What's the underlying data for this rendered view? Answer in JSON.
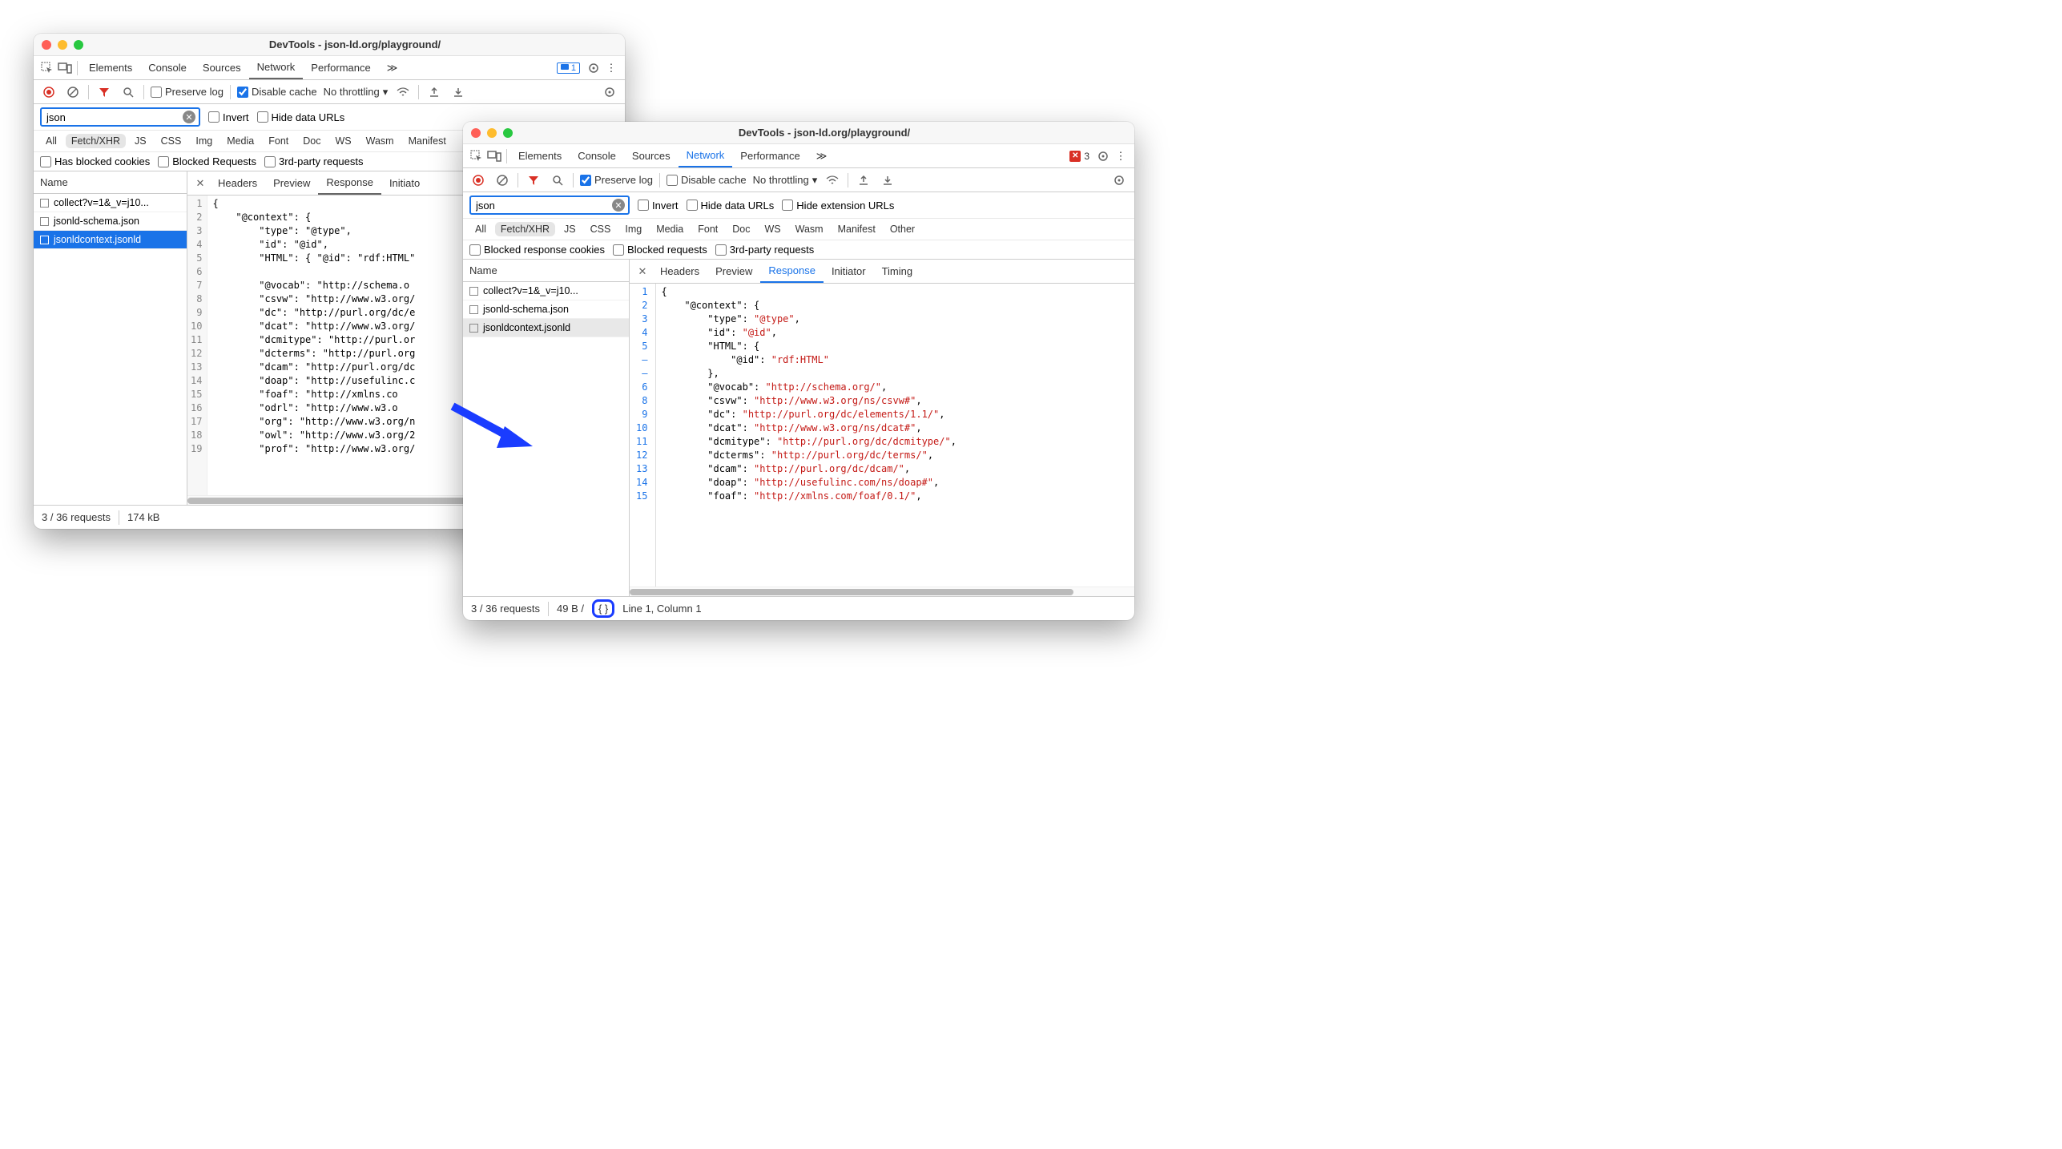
{
  "windowA": {
    "title": "DevTools - json-ld.org/playground/",
    "tabs": [
      "Elements",
      "Console",
      "Sources",
      "Network",
      "Performance"
    ],
    "activeTab": "Network",
    "more": "≫",
    "msgBadge": "1",
    "toolbar": {
      "preserve": "Preserve log",
      "disableCache": "Disable cache",
      "throttling": "No throttling"
    },
    "filter": {
      "value": "json",
      "invert": "Invert",
      "hideData": "Hide data URLs"
    },
    "types": [
      "All",
      "Fetch/XHR",
      "JS",
      "CSS",
      "Img",
      "Media",
      "Font",
      "Doc",
      "WS",
      "Wasm",
      "Manifest"
    ],
    "activeType": "Fetch/XHR",
    "extraFilters": {
      "blockedCookies": "Has blocked cookies",
      "blockedReq": "Blocked Requests",
      "thirdParty": "3rd-party requests"
    },
    "nameHeader": "Name",
    "requests": [
      "collect?v=1&_v=j10...",
      "jsonld-schema.json",
      "jsonldcontext.jsonld"
    ],
    "selectedReq": 2,
    "detailTabs": [
      "Headers",
      "Preview",
      "Response",
      "Initiato"
    ],
    "activeDetail": "Response",
    "gutter": [
      "1",
      "2",
      "3",
      "4",
      "5",
      "6",
      "7",
      "8",
      "9",
      "10",
      "11",
      "12",
      "13",
      "14",
      "15",
      "16",
      "17",
      "18",
      "19"
    ],
    "codePlain": [
      "{",
      "    \"@context\": {",
      "        \"type\": \"@type\",",
      "        \"id\": \"@id\",",
      "        \"HTML\": { \"@id\": \"rdf:HTML\"",
      "",
      "        \"@vocab\": \"http://schema.o",
      "        \"csvw\": \"http://www.w3.org/",
      "        \"dc\": \"http://purl.org/dc/e",
      "        \"dcat\": \"http://www.w3.org/",
      "        \"dcmitype\": \"http://purl.or",
      "        \"dcterms\": \"http://purl.org",
      "        \"dcam\": \"http://purl.org/dc",
      "        \"doap\": \"http://usefulinc.c",
      "        \"foaf\": \"http://xmlns.co",
      "        \"odrl\": \"http://www.w3.o",
      "        \"org\": \"http://www.w3.org/n",
      "        \"owl\": \"http://www.w3.org/2",
      "        \"prof\": \"http://www.w3.org/"
    ],
    "status": {
      "requests": "3 / 36 requests",
      "size": "174 kB"
    }
  },
  "windowB": {
    "title": "DevTools - json-ld.org/playground/",
    "tabs": [
      "Elements",
      "Console",
      "Sources",
      "Network",
      "Performance"
    ],
    "activeTab": "Network",
    "more": "≫",
    "errBadge": "3",
    "toolbar": {
      "preserve": "Preserve log",
      "disableCache": "Disable cache",
      "throttling": "No throttling"
    },
    "filter": {
      "value": "json",
      "invert": "Invert",
      "hideData": "Hide data URLs",
      "hideExt": "Hide extension URLs"
    },
    "types": [
      "All",
      "Fetch/XHR",
      "JS",
      "CSS",
      "Img",
      "Media",
      "Font",
      "Doc",
      "WS",
      "Wasm",
      "Manifest",
      "Other"
    ],
    "activeType": "Fetch/XHR",
    "extraFilters": {
      "blockedCookies": "Blocked response cookies",
      "blockedReq": "Blocked requests",
      "thirdParty": "3rd-party requests"
    },
    "nameHeader": "Name",
    "requests": [
      "collect?v=1&_v=j10...",
      "jsonld-schema.json",
      "jsonldcontext.jsonld"
    ],
    "selectedReq": 2,
    "detailTabs": [
      "Headers",
      "Preview",
      "Response",
      "Initiator",
      "Timing"
    ],
    "activeDetail": "Response",
    "gutter": [
      "1",
      "2",
      "3",
      "4",
      "5",
      "–",
      "–",
      "6",
      "8",
      "9",
      "10",
      "11",
      "12",
      "13",
      "14",
      "15"
    ],
    "codeLines": [
      {
        "indent": 0,
        "pre": "{"
      },
      {
        "indent": 1,
        "key": "\"@context\"",
        "post": ": {"
      },
      {
        "indent": 2,
        "key": "\"type\"",
        "mid": ": ",
        "val": "\"@type\"",
        "post": ","
      },
      {
        "indent": 2,
        "key": "\"id\"",
        "mid": ": ",
        "val": "\"@id\"",
        "post": ","
      },
      {
        "indent": 2,
        "key": "\"HTML\"",
        "post": ": {"
      },
      {
        "indent": 3,
        "key": "\"@id\"",
        "mid": ": ",
        "val": "\"rdf:HTML\""
      },
      {
        "indent": 2,
        "pre": "},"
      },
      {
        "indent": 2,
        "key": "\"@vocab\"",
        "mid": ": ",
        "val": "\"http://schema.org/\"",
        "post": ","
      },
      {
        "indent": 2,
        "key": "\"csvw\"",
        "mid": ": ",
        "val": "\"http://www.w3.org/ns/csvw#\"",
        "post": ","
      },
      {
        "indent": 2,
        "key": "\"dc\"",
        "mid": ": ",
        "val": "\"http://purl.org/dc/elements/1.1/\"",
        "post": ","
      },
      {
        "indent": 2,
        "key": "\"dcat\"",
        "mid": ": ",
        "val": "\"http://www.w3.org/ns/dcat#\"",
        "post": ","
      },
      {
        "indent": 2,
        "key": "\"dcmitype\"",
        "mid": ": ",
        "val": "\"http://purl.org/dc/dcmitype/\"",
        "post": ","
      },
      {
        "indent": 2,
        "key": "\"dcterms\"",
        "mid": ": ",
        "val": "\"http://purl.org/dc/terms/\"",
        "post": ","
      },
      {
        "indent": 2,
        "key": "\"dcam\"",
        "mid": ": ",
        "val": "\"http://purl.org/dc/dcam/\"",
        "post": ","
      },
      {
        "indent": 2,
        "key": "\"doap\"",
        "mid": ": ",
        "val": "\"http://usefulinc.com/ns/doap#\"",
        "post": ","
      },
      {
        "indent": 2,
        "key": "\"foaf\"",
        "mid": ": ",
        "val": "\"http://xmlns.com/foaf/0.1/\"",
        "post": ","
      }
    ],
    "status": {
      "requests": "3 / 36 requests",
      "size": "49 B /",
      "cursor": "Line 1, Column 1"
    }
  }
}
